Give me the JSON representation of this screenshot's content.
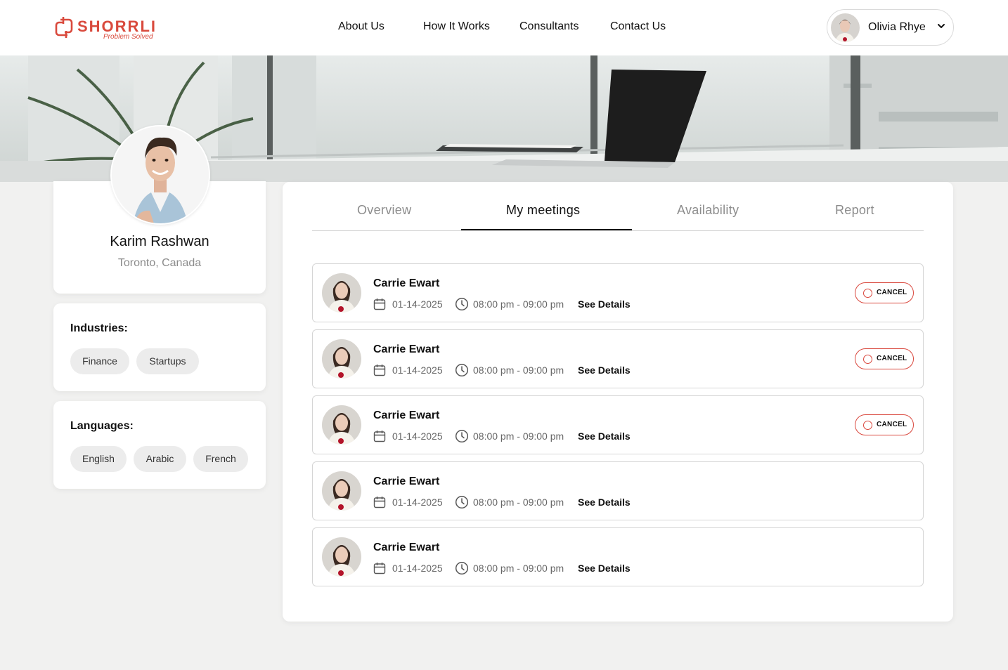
{
  "header": {
    "logo_text": "SHORRLI",
    "logo_tagline": "Problem Solved",
    "nav": [
      "About Us",
      "How It Works",
      "Consultants",
      "Contact Us"
    ],
    "user_name": "Olivia Rhye"
  },
  "profile": {
    "name": "Karim Rashwan",
    "location": "Toronto, Canada"
  },
  "industries": {
    "heading": "Industries:",
    "items": [
      "Finance",
      "Startups"
    ]
  },
  "languages": {
    "heading": "Languages:",
    "items": [
      "English",
      "Arabic",
      "French"
    ]
  },
  "tabs": {
    "items": [
      "Overview",
      "My meetings",
      "Availability",
      "Report"
    ],
    "active": "My meetings"
  },
  "meetings": [
    {
      "name": "Carrie Ewart",
      "date": "01-14-2025",
      "time": "08:00 pm - 09:00 pm",
      "details_label": "See Details",
      "cancel_label": "CANCEL"
    },
    {
      "name": "Carrie Ewart",
      "date": "01-14-2025",
      "time": "08:00 pm - 09:00 pm",
      "details_label": "See Details",
      "cancel_label": "CANCEL"
    },
    {
      "name": "Carrie Ewart",
      "date": "01-14-2025",
      "time": "08:00 pm - 09:00 pm",
      "details_label": "See Details",
      "cancel_label": "CANCEL"
    },
    {
      "name": "Carrie Ewart",
      "date": "01-14-2025",
      "time": "08:00 pm - 09:00 pm",
      "details_label": "See Details"
    },
    {
      "name": "Carrie Ewart",
      "date": "01-14-2025",
      "time": "08:00 pm - 09:00 pm",
      "details_label": "See Details"
    }
  ],
  "colors": {
    "brand": "#d94a3d",
    "background": "#f1f1f0",
    "chip": "#ececec"
  }
}
